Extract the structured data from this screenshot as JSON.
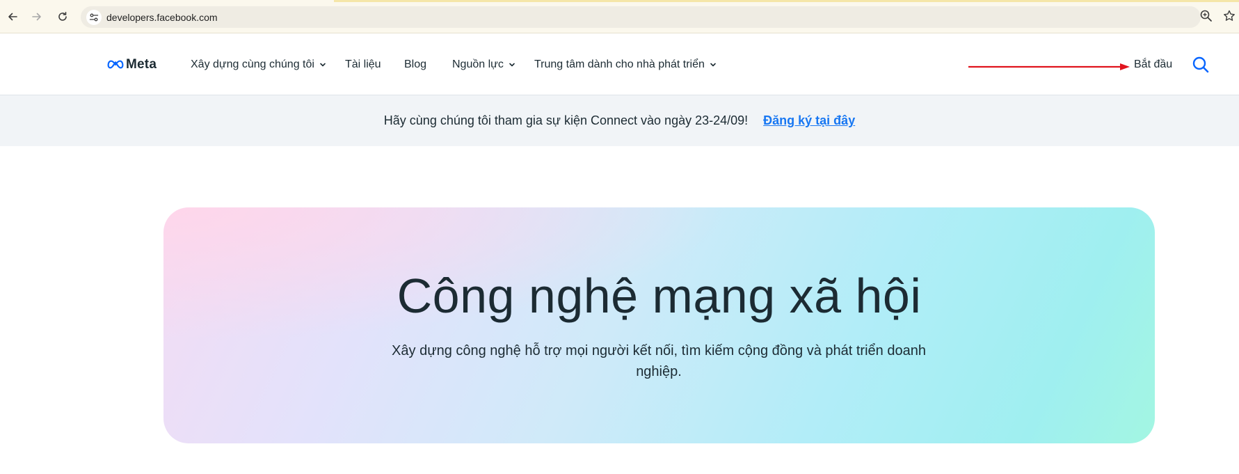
{
  "browser": {
    "url": "developers.facebook.com",
    "icons": [
      "back-arrow-icon",
      "forward-arrow-icon",
      "reload-icon",
      "site-settings-icon",
      "zoom-icon",
      "bookmark-star-icon"
    ]
  },
  "header": {
    "logo_text": "Meta",
    "nav": [
      {
        "label": "Xây dựng cùng chúng tôi",
        "has_dropdown": true
      },
      {
        "label": "Tài liệu",
        "has_dropdown": false
      },
      {
        "label": "Blog",
        "has_dropdown": false
      },
      {
        "label": "Nguồn lực",
        "has_dropdown": true
      },
      {
        "label": "Trung tâm dành cho nhà phát triển",
        "has_dropdown": true
      }
    ],
    "start_label": "Bắt đầu",
    "search_icon": "search-icon"
  },
  "banner": {
    "text": "Hãy cùng chúng tôi tham gia sự kiện Connect vào ngày 23-24/09!",
    "link_label": "Đăng ký tại đây"
  },
  "hero": {
    "title": "Công nghệ mạng xã hội",
    "subtitle": "Xây dựng công nghệ hỗ trợ mọi người kết nối, tìm kiếm cộng đồng và phát triển doanh nghiệp."
  },
  "colors": {
    "text": "#1c2b33",
    "link": "#1877f2",
    "annotation_arrow": "#e0141e",
    "banner_bg": "#f1f4f7"
  }
}
